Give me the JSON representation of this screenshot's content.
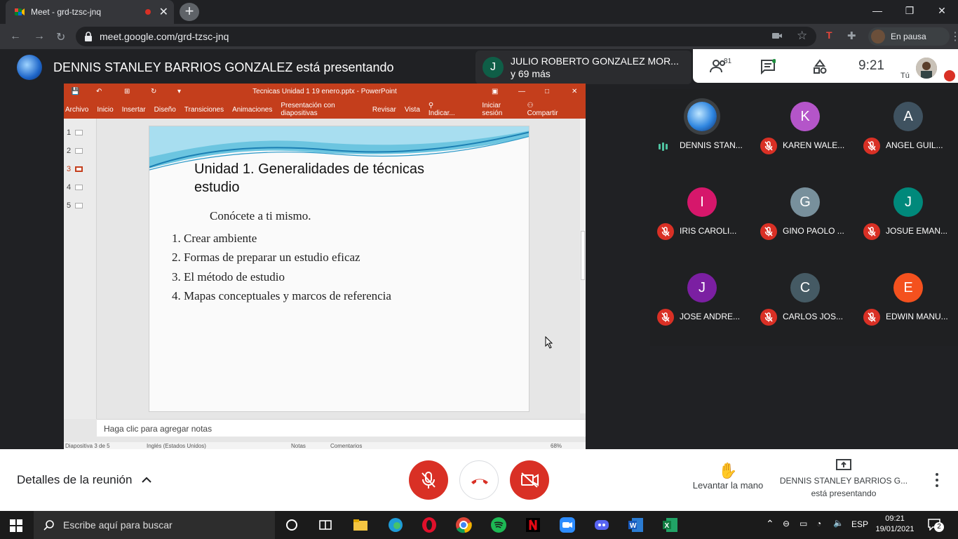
{
  "browser": {
    "tab_title": "Meet - grd-tzsc-jnq",
    "url": "meet.google.com/grd-tzsc-jnq",
    "profile_label": "En pausa"
  },
  "meet": {
    "presenting_banner": "DENNIS STANLEY BARRIOS GONZALEZ está presentando",
    "speaker_name": "JULIO ROBERTO GONZALEZ MOR...",
    "speaker_more": "y 69 más",
    "participant_count": "81",
    "time": "9:21",
    "self_label": "Tú",
    "participants": [
      {
        "name": "DENNIS STAN...",
        "initial": "",
        "color": "#1e66c9",
        "speaking": true
      },
      {
        "name": "KAREN WALE...",
        "initial": "K",
        "color": "#b455c9"
      },
      {
        "name": "ANGEL GUIL...",
        "initial": "A",
        "color": "#3f5260"
      },
      {
        "name": "IRIS CAROLI...",
        "initial": "I",
        "color": "#d6176b"
      },
      {
        "name": "GINO PAOLO ...",
        "initial": "G",
        "color": "#78909c"
      },
      {
        "name": "JOSUE EMAN...",
        "initial": "J",
        "color": "#00897b"
      },
      {
        "name": "JOSE ANDRE...",
        "initial": "J",
        "color": "#7b1fa2"
      },
      {
        "name": "CARLOS JOS...",
        "initial": "C",
        "color": "#455a64"
      },
      {
        "name": "EDWIN MANU...",
        "initial": "E",
        "color": "#f4511e"
      }
    ],
    "details_label": "Detalles de la reunión",
    "raise_hand_label": "Levantar la mano",
    "presenting_line1": "DENNIS STANLEY BARRIOS G...",
    "presenting_line2": "está presentando"
  },
  "ppt": {
    "window_title": "Tecnicas Unidad 1 19 enero.pptx - PowerPoint",
    "ribbon": [
      "Archivo",
      "Inicio",
      "Insertar",
      "Diseño",
      "Transiciones",
      "Animaciones",
      "Presentación con diapositivas",
      "Revisar",
      "Vista",
      "Indicar...",
      "Iniciar sesión",
      "Compartir"
    ],
    "thumbs": [
      "1",
      "2",
      "3",
      "4",
      "5"
    ],
    "active_slide": 3,
    "slide_title": "Unidad 1. Generalidades de técnicas estudio",
    "slide_subtitle": "Conócete a ti mismo.",
    "slide_items": [
      "1. Crear ambiente",
      "2. Formas de preparar un estudio eficaz",
      "3. El método de estudio",
      "4. Mapas conceptuales y marcos de referencia"
    ],
    "notes_placeholder": "Haga clic para agregar notas",
    "status_slide": "Diapositiva 3 de 5",
    "status_lang": "Inglés (Estados Unidos)",
    "status_notes": "Notas",
    "status_comments": "Comentarios",
    "zoom": "68%"
  },
  "taskbar": {
    "search_placeholder": "Escribe aquí para buscar",
    "lang": "ESP",
    "time": "09:21",
    "date": "19/01/2021",
    "notifications": "2"
  }
}
